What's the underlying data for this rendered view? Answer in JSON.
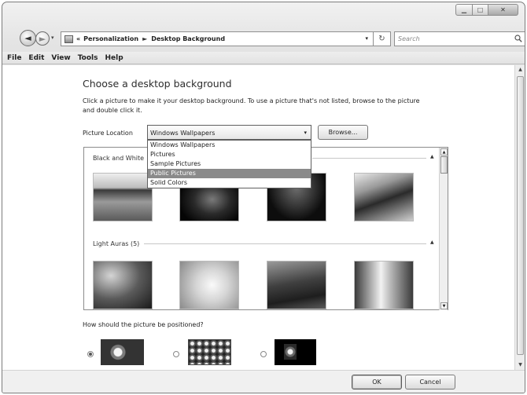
{
  "window": {
    "caption_buttons": {
      "minimize_icon": "minimize-icon",
      "maximize_icon": "maximize-icon",
      "close_icon": "close-icon"
    }
  },
  "nav": {
    "back_glyph": "◄",
    "forward_glyph": "►",
    "dropdown_glyph": "▾",
    "address": {
      "overflow": "«",
      "crumbs": [
        "Personalization",
        "Desktop Background"
      ],
      "separator": "►",
      "dropdown_glyph": "▾"
    },
    "refresh_glyph": "↻",
    "search_placeholder": "Search"
  },
  "menu": [
    "File",
    "Edit",
    "View",
    "Tools",
    "Help"
  ],
  "page": {
    "heading": "Choose a desktop background",
    "instruction": "Click a picture to make it your desktop background. To use a picture that's not listed, browse to the picture and double click it.",
    "location_label": "Picture Location",
    "location_value": "Windows Wallpapers",
    "location_dropdown_glyph": "▾",
    "browse_label": "Browse...",
    "location_options": [
      "Windows Wallpapers",
      "Pictures",
      "Sample Pictures",
      "Public Pictures",
      "Solid Colors"
    ],
    "location_highlighted": "Public Pictures"
  },
  "gallery": {
    "groups": [
      {
        "title": "Black and White",
        "collapse_glyph": "▲"
      },
      {
        "title": "Light Auras (5)",
        "collapse_glyph": "▲"
      }
    ]
  },
  "position": {
    "question": "How should the picture be positioned?",
    "options": [
      "fill",
      "tile",
      "center"
    ],
    "selected": "fill"
  },
  "footer": {
    "ok": "OK",
    "cancel": "Cancel"
  }
}
